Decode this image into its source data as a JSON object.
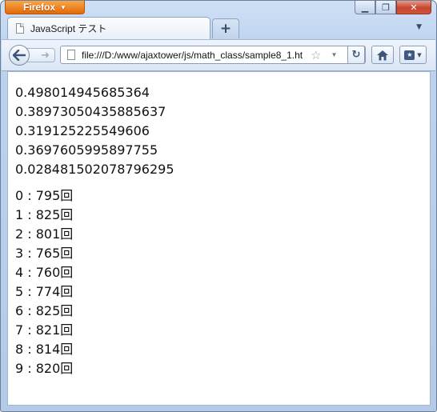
{
  "browser": {
    "menu_button": "Firefox",
    "tab_title": "JavaScript テスト",
    "url": "file:///D:/www/ajaxtower/js/math_class/sample8_1.ht"
  },
  "page": {
    "random_numbers": [
      "0.498014945685364",
      "0.38973050435885637",
      "0.319125225549606",
      "0.3697605995897755",
      "0.028481502078796295"
    ],
    "counts": [
      "0 : 795回",
      "1 : 825回",
      "2 : 801回",
      "3 : 765回",
      "4 : 760回",
      "5 : 774回",
      "6 : 825回",
      "7 : 821回",
      "8 : 814回",
      "9 : 820回"
    ]
  },
  "icons": {
    "back": "back-arrow-icon",
    "forward": "forward-arrow-icon",
    "reload": "reload-icon",
    "home": "home-icon",
    "bookmark": "bookmark-star-icon",
    "bookmarks_menu": "bookmarks-menu-icon"
  }
}
